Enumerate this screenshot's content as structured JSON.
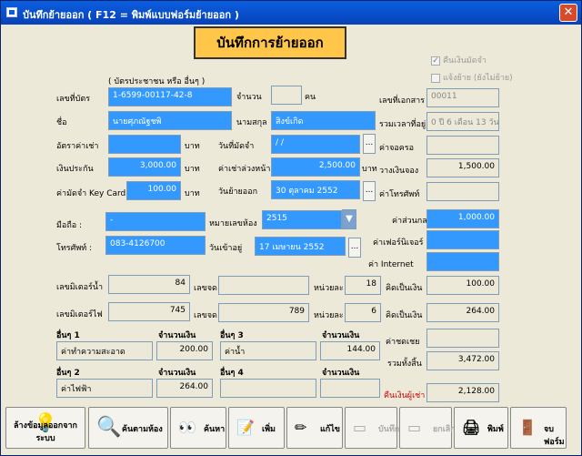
{
  "window": {
    "title": "บันทึกย้ายออก ( F12 = พิมพ์แบบฟอร์มย้ายออก )"
  },
  "heading": "บันทึกการย้ายออก",
  "checkboxes": {
    "refund": "คืนเงินมัดจำ",
    "notify": "แจ้งย้าย (ยังไม่ย้าย)"
  },
  "form": {
    "id_hint": "( บัตรประชาชน หรือ อื่นๆ )",
    "id_label": "เลขที่บัตร",
    "id_value": "1-6599-00117-42-8",
    "count_label": "จำนวน",
    "count_value": "",
    "count_unit": "คน",
    "doc_label": "เลขที่เอกสาร",
    "doc_value": "00011",
    "name_label": "ชื่อ",
    "name_value": "นายศุภณัฐชพิ",
    "surname_label": "นามสกุล",
    "surname_value": "สิงข์เกิด",
    "stay_label": "รวมเวลาที่อยู่",
    "stay_value": "0 ปี 6 เดือน 13 วัน",
    "rent_label": "อัตราค่าเช่า",
    "rent_value": "",
    "rent_unit": "บาท",
    "deposit_date_label": "วันที่มัดจำ",
    "deposit_date_value": " / /",
    "reserve_fee_label": "ค่าจอครอ",
    "reserve_fee_value": "",
    "insurance_label": "เงินประกัน",
    "insurance_value": "3,000.00",
    "insurance_unit": "บาท",
    "advance_label": "ค่าเช่าล่วงหน้า",
    "advance_value": "2,500.00",
    "advance_unit": "บาท",
    "reserve_label": "วางเงินจอง",
    "reserve_value": "1,500.00",
    "keycard_label": "ค่ามัดจำ Key Card",
    "keycard_value": "100.00",
    "keycard_unit": "บาท",
    "moveout_label": "วันย้ายออก",
    "moveout_value": "30 ตุลาคม 2552",
    "phone_fee_label": "ค่าโทรศัพท์",
    "phone_fee_value": "",
    "mobile_label": "มือถือ :",
    "mobile_value": "-",
    "room_label": "หมายเลขห้อง",
    "room_value": "2515",
    "common_label": "ค่าส่วนกลาง",
    "common_value": "1,000.00",
    "phone_label": "โทรศัพท์ :",
    "phone_value": "083-4126700",
    "movein_label": "วันเข้าอยู่",
    "movein_value": "17 เมษายน 2552",
    "furniture_label": "ค่าเฟอร์นิเจอร์",
    "furniture_value": "",
    "internet_label": "ค่า Internet",
    "internet_value": "",
    "water_meter_label": "เลขมิเตอร์น้ำ",
    "water_meter_value": "84",
    "water_prev_label": "เลขจด",
    "water_prev_value": "",
    "water_unit_label": "หน่วยละ",
    "water_unit_value": "18",
    "water_total_label": "คิดเป็นเงิน",
    "water_total_value": "100.00",
    "elec_meter_label": "เลขมิเตอร์ไฟ",
    "elec_meter_value": "745",
    "elec_prev_label": "เลขจด",
    "elec_prev_value": "789",
    "elec_unit_label": "หน่วยละ",
    "elec_unit_value": "6",
    "elec_total_label": "คิดเป็นเงิน",
    "elec_total_value": "264.00",
    "other1_label": "อื่นๆ 1",
    "other1_amount_label": "จำนวนเงิน",
    "other1_name": "ค่าทำความสะอาด",
    "other1_amount": "200.00",
    "other2_label": "อื่นๆ 2",
    "other2_amount_label": "จำนวนเงิน",
    "other2_name": "ค่าไฟฟ้า",
    "other2_amount": "264.00",
    "other3_label": "อื่นๆ 3",
    "other3_amount_label": "จำนวนเงิน",
    "other3_name": "ค่าน้ำ",
    "other3_amount": "144.00",
    "other4_label": "อื่นๆ 4",
    "other4_amount_label": "จำนวนเงิน",
    "other4_name": "",
    "other4_amount": "",
    "damage_label": "ค่าชดเชย",
    "damage_value": "",
    "total_label": "รวมทั้งสิ้น",
    "total_value": "3,472.00",
    "refund_label": "คืนเงินผู้เช่า",
    "refund_value": "2,128.00"
  },
  "buttons": {
    "clear": "ล้างข้อมูลออกจากระบบ",
    "search_room": "ค้นตามห้อง",
    "find": "ค้นหา",
    "add": "เพิ่ม",
    "edit": "แก้ไข",
    "save": "บันทึก",
    "cancel": "ยกเลิก",
    "print": "พิมพ์",
    "exit": "จบฟอร์ม"
  },
  "colors": {
    "field_blue": "#3399ff",
    "heading_bg": "#ffc64a",
    "refund_red": "#cc0000"
  }
}
